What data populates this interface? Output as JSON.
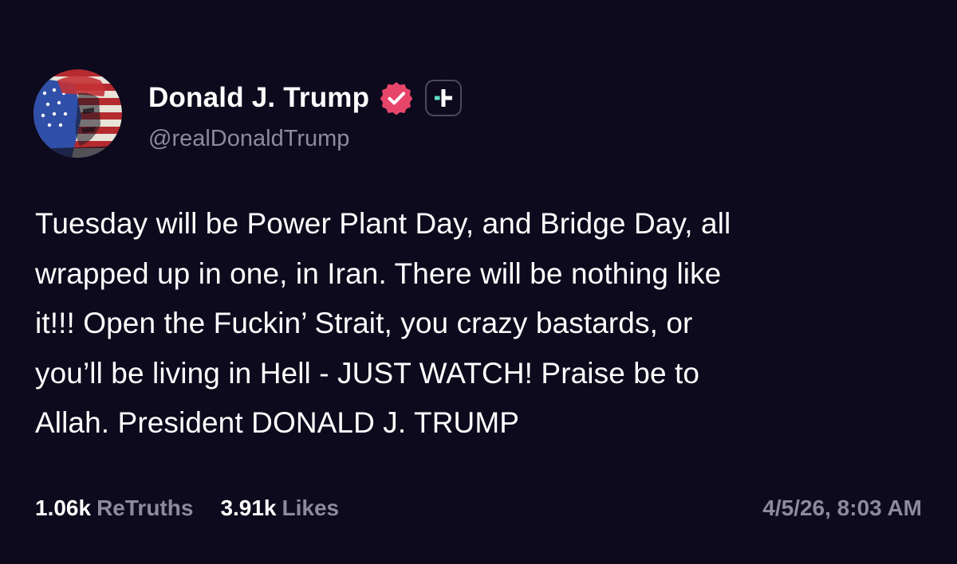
{
  "author": {
    "display_name": "Donald J. Trump",
    "username": "@realDonaldTrump",
    "verified_icon": "verified-badge-icon",
    "follow_icon": "plus-icon"
  },
  "post": {
    "lines": [
      "Tuesday will be Power Plant Day, and Bridge Day, all",
      "wrapped up in one, in Iran. There will be nothing like",
      "it!!! Open the Fuckin’ Strait, you crazy bastards, or",
      "you’ll be living in Hell - JUST WATCH! Praise be to",
      "Allah. President DONALD J. TRUMP"
    ]
  },
  "stats": {
    "retruths_count": "1.06k",
    "retruths_label": "ReTruths",
    "likes_count": "3.91k",
    "likes_label": "Likes"
  },
  "timestamp": "4/5/26, 8:03 AM",
  "colors": {
    "background": "#0c0a1c",
    "verified_badge": "#e8456b",
    "follow_accent": "#5de0c6",
    "muted_text": "#8c8a9c"
  }
}
